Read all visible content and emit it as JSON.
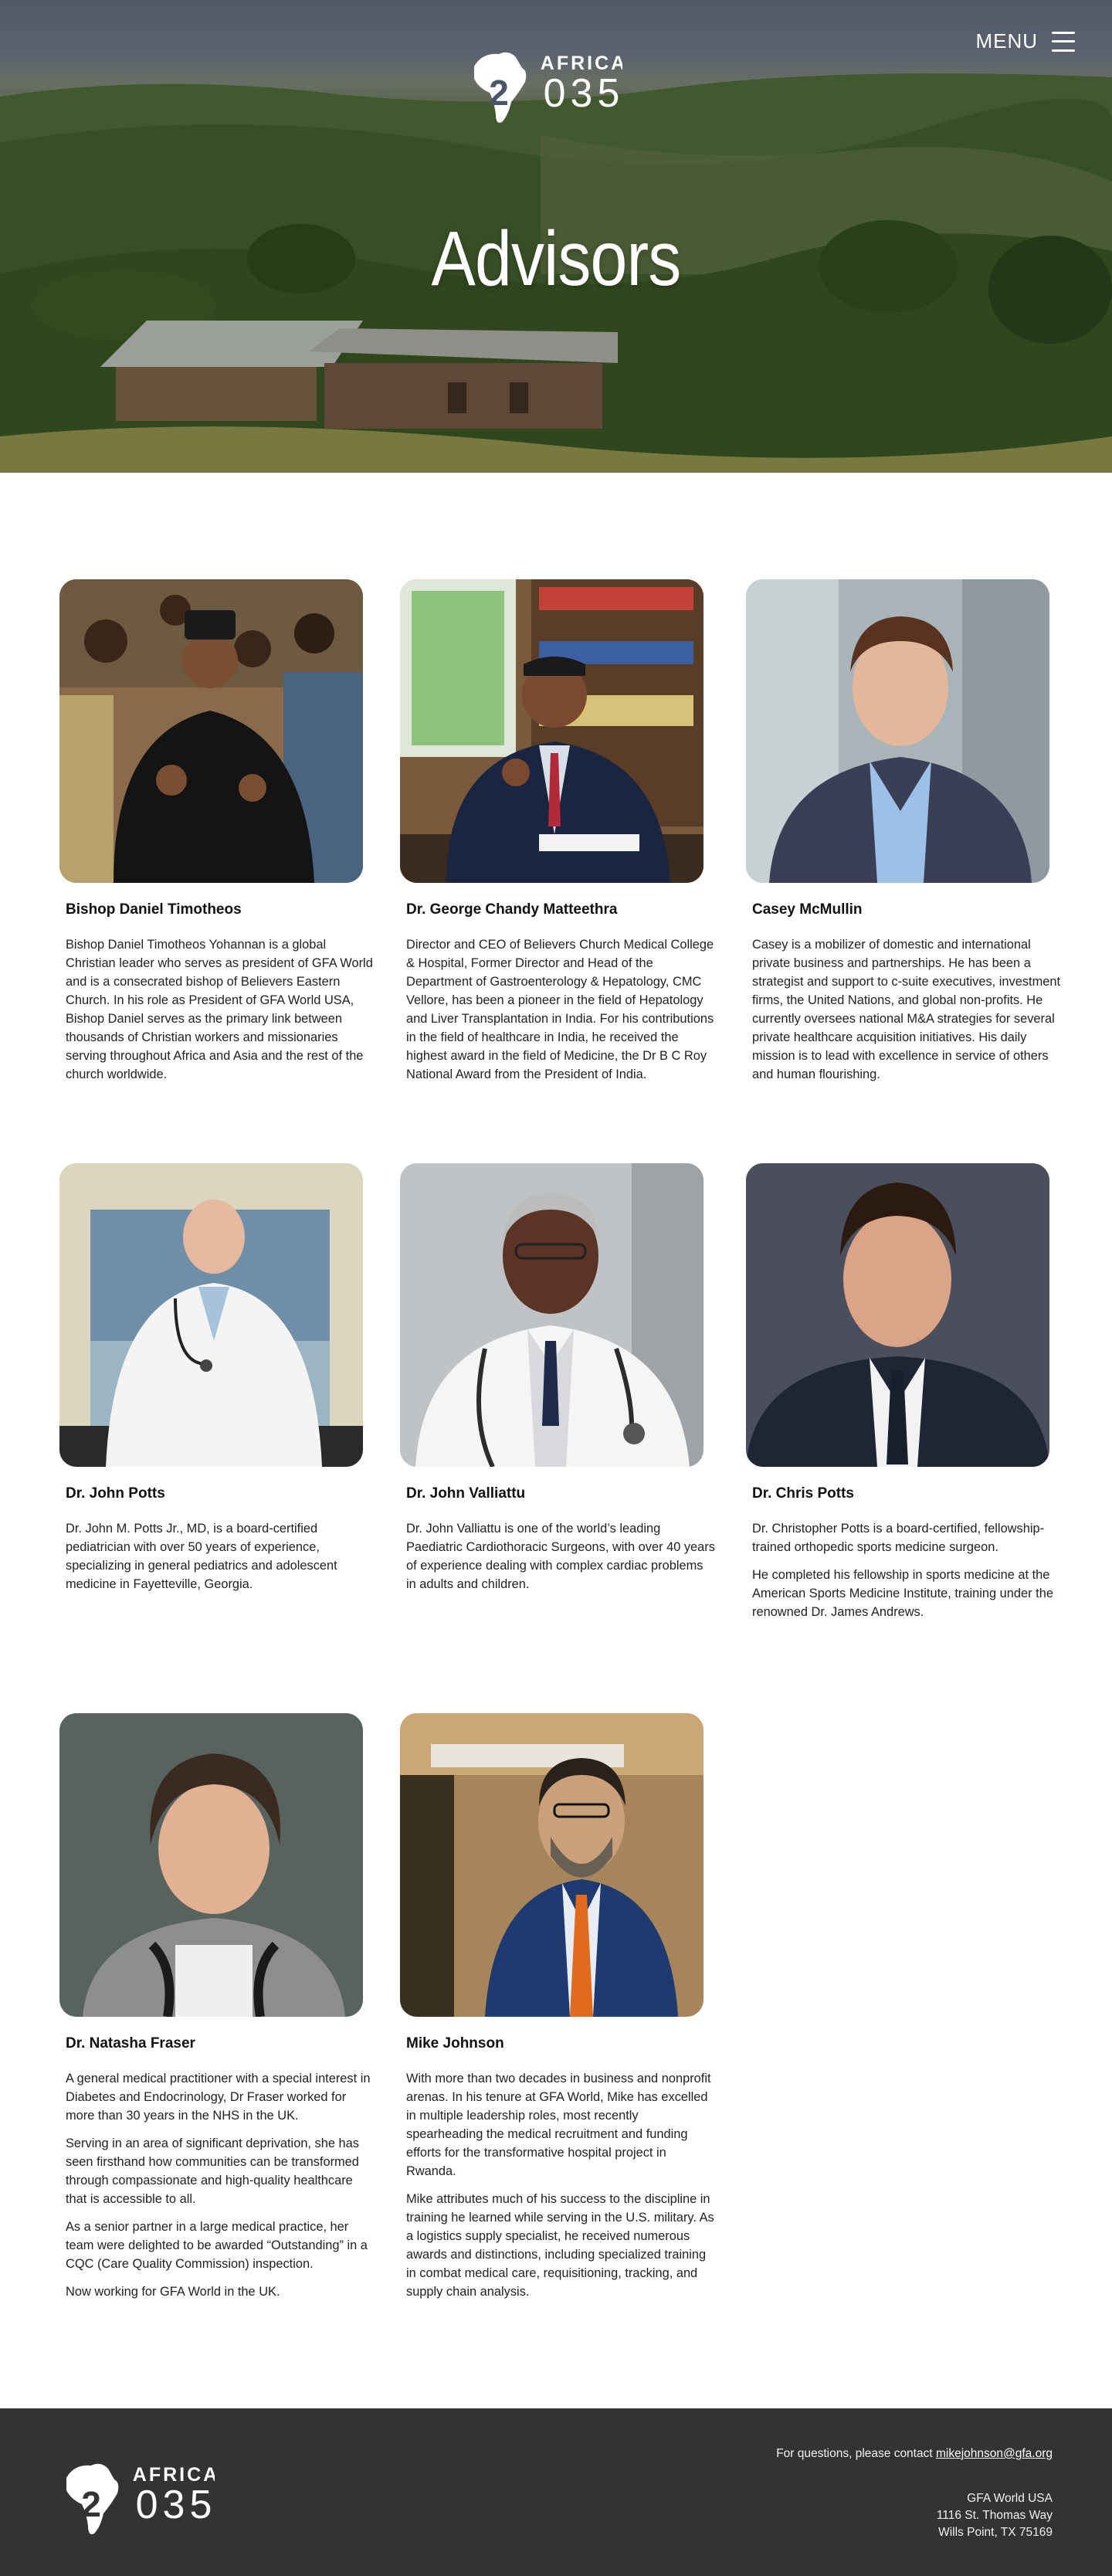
{
  "header": {
    "logo_word": "AFRICA",
    "logo_digits": "2035",
    "menu_label": "MENU",
    "title": "Advisors"
  },
  "advisors": [
    {
      "name": "Bishop Daniel Timotheos",
      "bio": [
        "Bishop Daniel Timotheos Yohannan is a global Christian leader who serves as president of GFA World and is a consecrated bishop of Believers  Eastern Church. In his role as President of GFA World USA, Bishop Daniel serves as the primary link between thousands of Christian workers and  missionaries serving throughout Africa and Asia and the rest of the church worldwide."
      ]
    },
    {
      "name": "Dr. George Chandy Matteethra",
      "bio": [
        "Director and CEO of Believers Church Medical College & Hospital,  Former Director and Head of the Department of Gastroenterology & Hepatology, CMC Vellore, has been a pioneer in the field of Hepatology  and Liver Transplantation in India. For his contributions in the field  of healthcare in India, he received the highest award in the field of  Medicine, the Dr B C Roy National Award from the President of India."
      ]
    },
    {
      "name": "Casey McMullin",
      "bio": [
        "Casey is a mobilizer of domestic and international private business and partnerships. He has been a strategist and support to c-suite  executives, investment firms, the United Nations, and global  non-profits. He currently oversees national M&A strategies for  several private healthcare acquisition initiatives. His daily mission is to lead with excellence in service of others and human flourishing."
      ]
    },
    {
      "name": "Dr. John Potts",
      "bio": [
        "Dr. John M. Potts Jr., MD, is a board-certified pediatrician with over   50 years of experience, specializing in general pediatrics and adolescent medicine in Fayetteville, Georgia."
      ]
    },
    {
      "name": "Dr. John Valliattu",
      "bio": [
        "Dr. John Valliattu is one of the world’s leading Paediatric  Cardiothoracic Surgeons, with over 40 years of experience dealing with  complex cardiac problems in adults and children."
      ]
    },
    {
      "name": "Dr. Chris Potts",
      "bio": [
        "Dr. Christopher Potts is a board-certified, fellowship-trained orthopedic sports medicine surgeon.",
        "He completed his fellowship in sports medicine at the American Sports Medicine Institute, training under the renowned Dr. James Andrews."
      ]
    },
    {
      "name": "Dr. Natasha Fraser",
      "bio": [
        "A general medical practitioner with a special interest in Diabetes and Endocrinology, Dr Fraser worked for more than 30 years in the NHS in the UK.",
        "Serving in an area of significant deprivation, she has seen firsthand how communities can be transformed through compassionate and high-quality healthcare that is accessible to all.",
        "As a senior partner in a large medical practice, her team were delighted to be awarded “Outstanding” in a CQC (Care Quality Commission) inspection.",
        "Now working for GFA World in the UK."
      ]
    },
    {
      "name": "Mike Johnson",
      "bio": [
        "With more than two decades in business and nonprofit arenas. In his tenure at GFA World, Mike has excelled in multiple leadership roles, most recently spearheading the medical recruitment and funding efforts for the transformative hospital project in Rwanda.",
        "Mike attributes much of his success to the discipline in training he learned while serving in the U.S. military. As a logistics supply specialist, he received numerous awards and distinctions, including specialized training in combat medical care, requisitioning, tracking, and supply chain analysis."
      ]
    }
  ],
  "footer": {
    "contact_prefix": "For questions, please contact ",
    "contact_email": "mikejohnson@gfa.org",
    "address_line1": "GFA World USA",
    "address_line2": "1116 St. Thomas Way",
    "address_line3": "Wills Point, TX 75169"
  }
}
